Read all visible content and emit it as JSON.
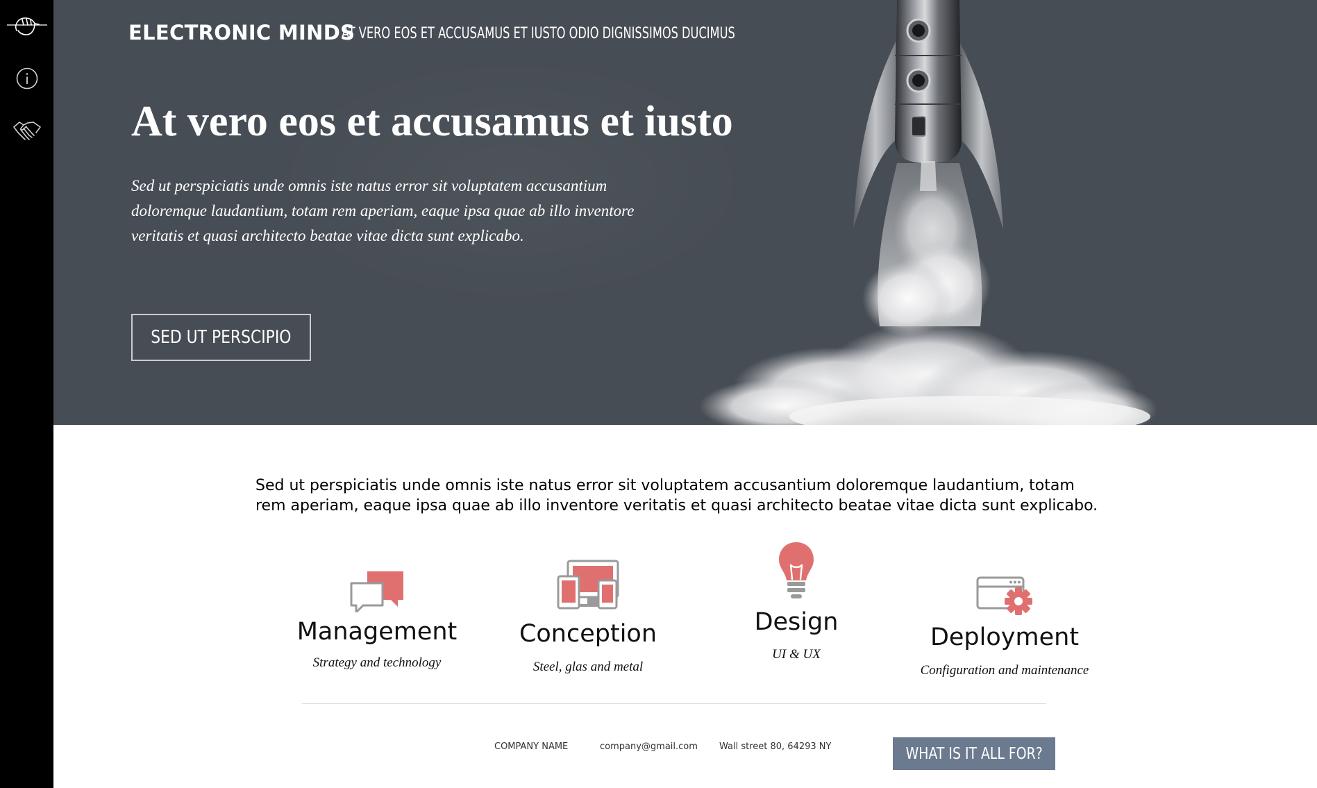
{
  "sidebar": {
    "icons": [
      "logo-hand-icon",
      "info-icon",
      "handshake-icon"
    ]
  },
  "header": {
    "brand": "ELECTRONIC MINDS",
    "tagline": "AT VERO EOS ET ACCUSAMUS ET IUSTO ODIO DIGNISSIMOS DUCIMUS"
  },
  "hero": {
    "title": "At vero eos et accusamus et iusto",
    "text": "Sed ut perspiciatis unde omnis iste natus error sit voluptatem accusantium doloremque laudantium, totam rem aperiam, eaque ipsa quae ab illo inventore veritatis et quasi architecto beatae vitae dicta sunt explicabo.",
    "button_label": "SED UT PERSCIPIO",
    "background_color": "#474d54"
  },
  "intro": {
    "text": "Sed ut perspiciatis unde omnis iste natus error sit voluptatem accusantium doloremque laudantium, totam rem aperiam, eaque ipsa quae ab illo inventore veritatis et quasi architecto beatae vitae dicta sunt explicabo."
  },
  "features": [
    {
      "icon": "chat-bubbles-icon",
      "title": "Management",
      "subtitle": "Strategy and technology"
    },
    {
      "icon": "devices-icon",
      "title": "Conception",
      "subtitle": "Steel, glas and metal"
    },
    {
      "icon": "lightbulb-icon",
      "title": "Design",
      "subtitle": "UI & UX"
    },
    {
      "icon": "browser-gear-icon",
      "title": "Deployment",
      "subtitle": "Configuration and maintenance"
    }
  ],
  "footer": {
    "company": "COMPANY NAME",
    "email": "company@gmail.com",
    "address": "Wall street 80, 64293 NY",
    "button_label": "WHAT IS IT ALL FOR?"
  },
  "colors": {
    "accent": "#e07070",
    "icon_gray": "#9a9a9a",
    "footer_button": "#6b7a8f"
  }
}
